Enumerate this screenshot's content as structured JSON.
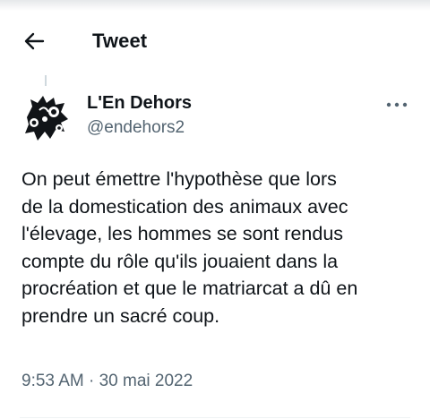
{
  "header": {
    "title": "Tweet",
    "back_icon": "arrow-left-icon"
  },
  "author": {
    "display_name": "L'En Dehors",
    "handle": "@endehors2",
    "avatar_icon": "avatar-image"
  },
  "more_icon": "more-horizontal-icon",
  "tweet": {
    "lines": [
      "On peut émettre l'hypothèse que lors",
      "de la domestication des animaux avec",
      "l'élevage, les hommes se sont rendus",
      "compte du rôle qu'ils jouaient dans la",
      "procréation et que le matriarcat a dû en",
      "prendre un sacré coup."
    ],
    "timestamp": "9:53 AM · 30 mai 2022"
  },
  "colors": {
    "text_primary": "#0f1419",
    "text_secondary": "#536471",
    "divider": "#eff3f4"
  }
}
